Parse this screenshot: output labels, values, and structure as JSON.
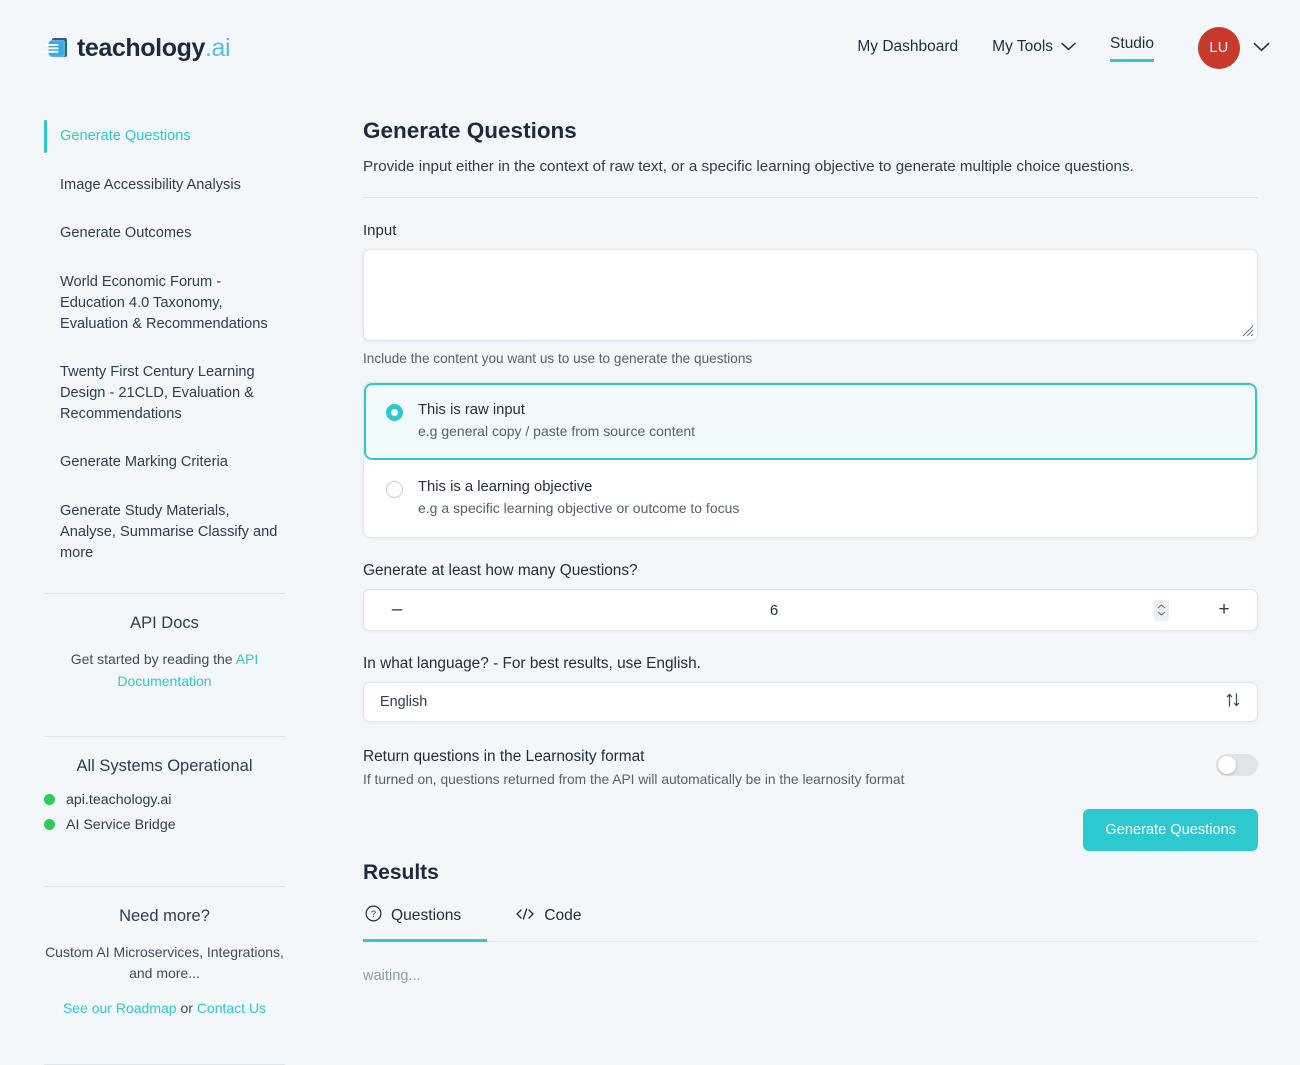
{
  "brand": {
    "name": "teachology",
    "suffix": ".ai",
    "logo_icon": "stacked-pages-icon"
  },
  "topnav": {
    "dashboard": "My Dashboard",
    "tools": "My Tools",
    "studio": "Studio",
    "avatar_initials": "LU",
    "accent_color": "#2ec9ce",
    "avatar_color": "#c8382b"
  },
  "sidebar": {
    "items": [
      {
        "label": "Generate Questions",
        "active": true
      },
      {
        "label": "Image Accessibility Analysis",
        "active": false
      },
      {
        "label": "Generate Outcomes",
        "active": false
      },
      {
        "label": "World Economic Forum - Education 4.0 Taxonomy, Evaluation & Recommendations",
        "active": false
      },
      {
        "label": "Twenty First Century Learning Design - 21CLD, Evaluation & Recommendations",
        "active": false
      },
      {
        "label": "Generate Marking Criteria",
        "active": false
      },
      {
        "label": "Generate Study Materials, Analyse, Summarise Classify and more",
        "active": false
      }
    ],
    "api_docs": {
      "title": "API Docs",
      "text_before": "Get started by reading the ",
      "link": "API Documentation"
    },
    "status": {
      "title": "All Systems Operational",
      "dot_color": "#30cc52",
      "services": [
        {
          "name": "api.teachology.ai"
        },
        {
          "name": "AI Service Bridge"
        }
      ]
    },
    "need_more": {
      "title": "Need more?",
      "text": "Custom AI Microservices, Integrations, and more...",
      "link_roadmap": "See our Roadmap",
      "separator": " or ",
      "link_contact": "Contact Us"
    }
  },
  "main": {
    "title": "Generate Questions",
    "subtitle": "Provide input either in the context of raw text, or a specific learning objective to generate multiple choice questions.",
    "input_label": "Input",
    "input_value": "",
    "input_placeholder": "",
    "input_helper": "Include the content you want us to use to generate the questions",
    "options": [
      {
        "title": "This is raw input",
        "desc": "e.g general copy / paste from source content",
        "selected": true
      },
      {
        "title": "This is a learning objective",
        "desc": "e.g a specific learning objective or outcome to focus",
        "selected": false
      }
    ],
    "count_label": "Generate at least how many Questions?",
    "count_minus": "–",
    "count_value": "6",
    "count_plus": "+",
    "language_label": "In what language? - For best results, use English.",
    "language_value": "English",
    "learnosity_title": "Return questions in the Learnosity format",
    "learnosity_desc": "If turned on, questions returned from the API will automatically be in the learnosity format",
    "learnosity_on": false,
    "generate_button": "Generate Questions"
  },
  "results": {
    "title": "Results",
    "tabs": [
      {
        "label": "Questions",
        "icon": "question-circle-icon",
        "active": true
      },
      {
        "label": "Code",
        "icon": "code-brackets-icon",
        "active": false
      }
    ],
    "status_text": "waiting..."
  }
}
